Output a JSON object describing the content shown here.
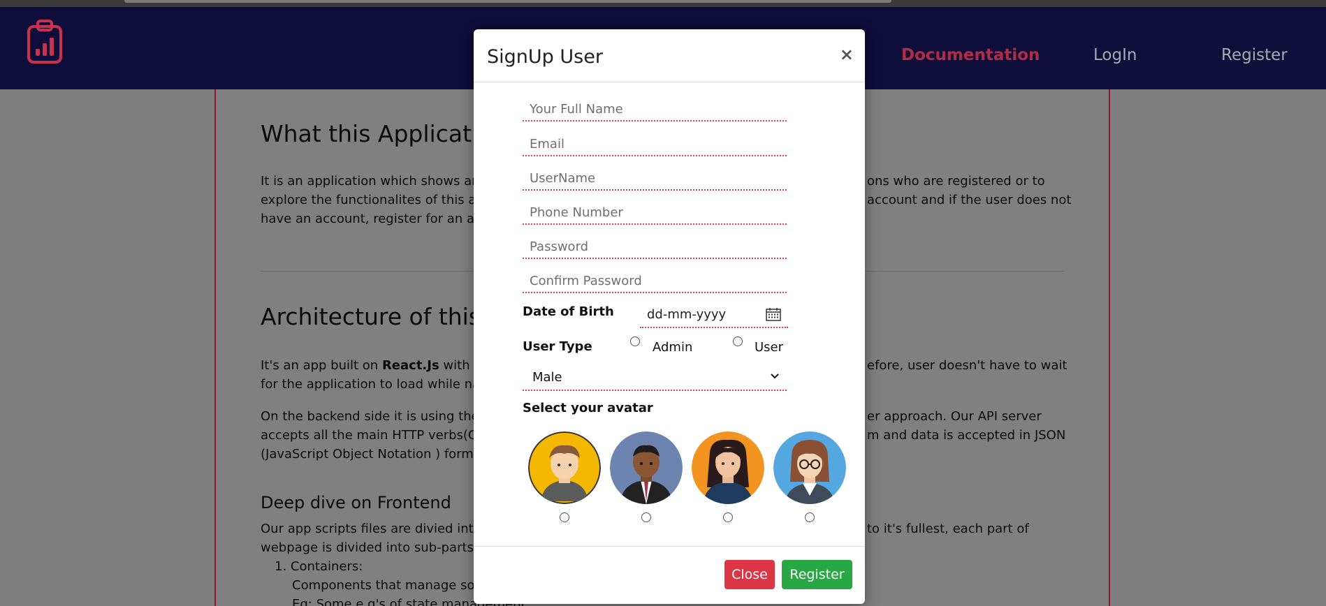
{
  "navbar": {
    "links": [
      "Documentation",
      "LogIn",
      "Register"
    ],
    "active_index": 0
  },
  "content": {
    "heading1": "What this Application",
    "para1_lines": [
      "It is an application which shows and",
      "explore the functionalites of this ap",
      "have an account, register for an acco"
    ],
    "para1_right_lines": [
      "ons who are registered or to",
      "account and if the user does not"
    ],
    "heading2": "Architecture of this",
    "para2_prefix": "It's an app built on ",
    "para2_bold": "React.Js",
    "para2_after": " with he",
    "para2_right": "efore, user doesn't have to wait",
    "para2_line2": "for the application to load while navi",
    "para3_line1": "On the backend side it is using the n",
    "para3_line1_right": "er approach. Our API server",
    "para3_line2": "accepts all the main HTTP verbs(GET",
    "para3_line2_right": "m and data is accepted in JSON",
    "para3_line3": "(JavaScript Object Notation ) form.",
    "heading3": "Deep dive on Frontend",
    "para4_line1": "Our app scripts files are divied into",
    "para4_line1_right": "to it's fullest, each part of",
    "para4_line2": "webpage is divided into sub-parts.",
    "list_item1": "1. Containers:",
    "list_item1_desc": "Components that manage some",
    "list_item1_eg": "Eg: Some e.g's of state management :"
  },
  "modal": {
    "title": "SignUp User",
    "close_x": "×",
    "fields": {
      "full_name": "Your Full Name",
      "email": "Email",
      "username": "UserName",
      "phone": "Phone Number",
      "password": "Password",
      "confirm_password": "Confirm Password"
    },
    "dob_label": "Date of Birth",
    "dob_value": "dd-mm-yyyy",
    "user_type_label": "User Type",
    "user_type_options": [
      "Admin",
      "User"
    ],
    "gender_selected": "Male",
    "avatar_label": "Select your avatar",
    "close_button": "Close",
    "register_button": "Register"
  },
  "colors": {
    "navbar_bg": "#0f0d3a",
    "accent_red": "#dc3545",
    "accent_green": "#28a745",
    "field_underline": "#e03a5c"
  }
}
